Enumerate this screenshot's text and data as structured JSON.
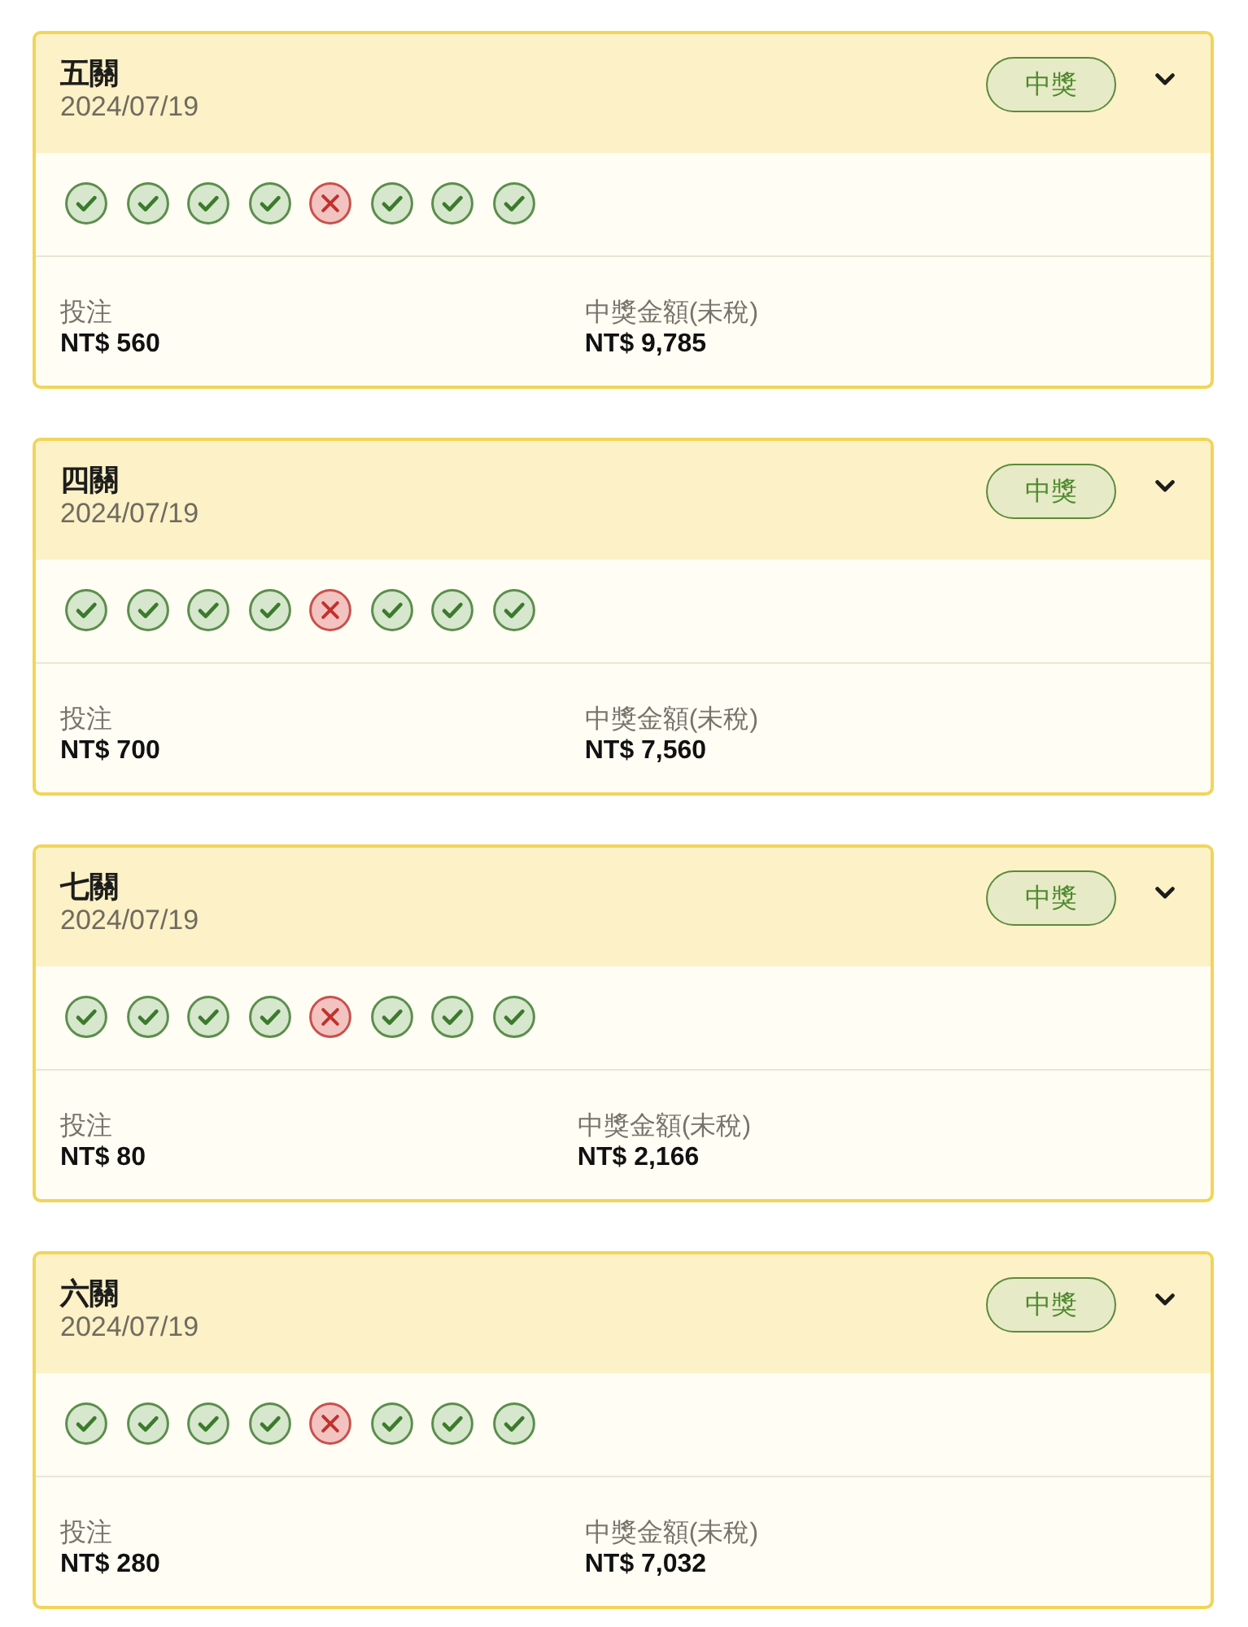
{
  "cards": [
    {
      "title": "五關",
      "date": "2024/07/19",
      "badge": "中獎",
      "picks": [
        {
          "correct": true
        },
        {
          "correct": true
        },
        {
          "correct": true
        },
        {
          "correct": true
        },
        {
          "correct": false
        },
        {
          "correct": true
        },
        {
          "correct": true
        },
        {
          "correct": true
        }
      ],
      "stake_label": "投注",
      "stake": "NT$ 560",
      "payout_label": "中獎金額(未稅)",
      "payout": "NT$ 9,785"
    },
    {
      "title": "四關",
      "date": "2024/07/19",
      "badge": "中獎",
      "picks": [
        {
          "correct": true
        },
        {
          "correct": true
        },
        {
          "correct": true
        },
        {
          "correct": true
        },
        {
          "correct": false
        },
        {
          "correct": true
        },
        {
          "correct": true
        },
        {
          "correct": true
        }
      ],
      "stake_label": "投注",
      "stake": "NT$ 700",
      "payout_label": "中獎金額(未稅)",
      "payout": "NT$ 7,560"
    },
    {
      "title": "七關",
      "date": "2024/07/19",
      "badge": "中獎",
      "picks": [
        {
          "correct": true
        },
        {
          "correct": true
        },
        {
          "correct": true
        },
        {
          "correct": true
        },
        {
          "correct": false
        },
        {
          "correct": true
        },
        {
          "correct": true
        },
        {
          "correct": true
        }
      ],
      "stake_label": "投注",
      "stake": "NT$ 80",
      "payout_label": "中獎金額(未稅)",
      "payout": "NT$ 2,166"
    },
    {
      "title": "六關",
      "date": "2024/07/19",
      "badge": "中獎",
      "picks": [
        {
          "correct": true
        },
        {
          "correct": true
        },
        {
          "correct": true
        },
        {
          "correct": true
        },
        {
          "correct": false
        },
        {
          "correct": true
        },
        {
          "correct": true
        },
        {
          "correct": true
        }
      ],
      "stake_label": "投注",
      "stake": "NT$ 280",
      "payout_label": "中獎金額(未稅)",
      "payout": "NT$ 7,032"
    }
  ]
}
